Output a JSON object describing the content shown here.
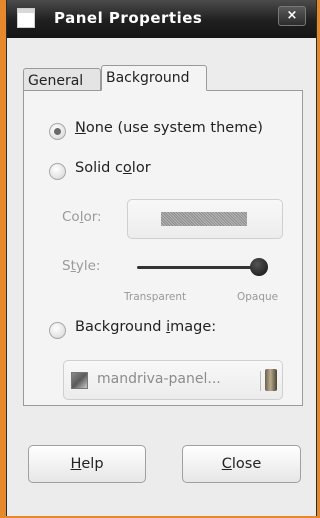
{
  "window": {
    "title": "Panel Properties",
    "close_glyph": "×"
  },
  "tabs": [
    {
      "label": "General",
      "active": false
    },
    {
      "label": "Background",
      "active": true
    }
  ],
  "background": {
    "option_none": {
      "mnemonic": "N",
      "rest": "one (use system theme)",
      "checked": true
    },
    "option_solid": {
      "before": "Solid c",
      "mnemonic": "o",
      "after": "lor",
      "checked": false
    },
    "color_label": {
      "before": "Co",
      "mnemonic": "l",
      "after": "or:"
    },
    "style_label": {
      "before": "S",
      "mnemonic": "t",
      "after": "yle:"
    },
    "style_value": 1.0,
    "scale_left": "Transparent",
    "scale_right": "Opaque",
    "option_image": {
      "before": "Background ",
      "mnemonic": "i",
      "after": "mage:",
      "checked": false
    },
    "image_file": "mandriva-panel...",
    "file_icon": "image-file-icon",
    "folder_icon": "folder-icon"
  },
  "buttons": {
    "help": {
      "mnemonic": "H",
      "rest": "elp"
    },
    "close": {
      "mnemonic": "C",
      "rest": "lose"
    }
  },
  "colors": {
    "desktop": "#e58a2c",
    "titlebar": "#1f1f1f",
    "dialog": "#ececec"
  }
}
